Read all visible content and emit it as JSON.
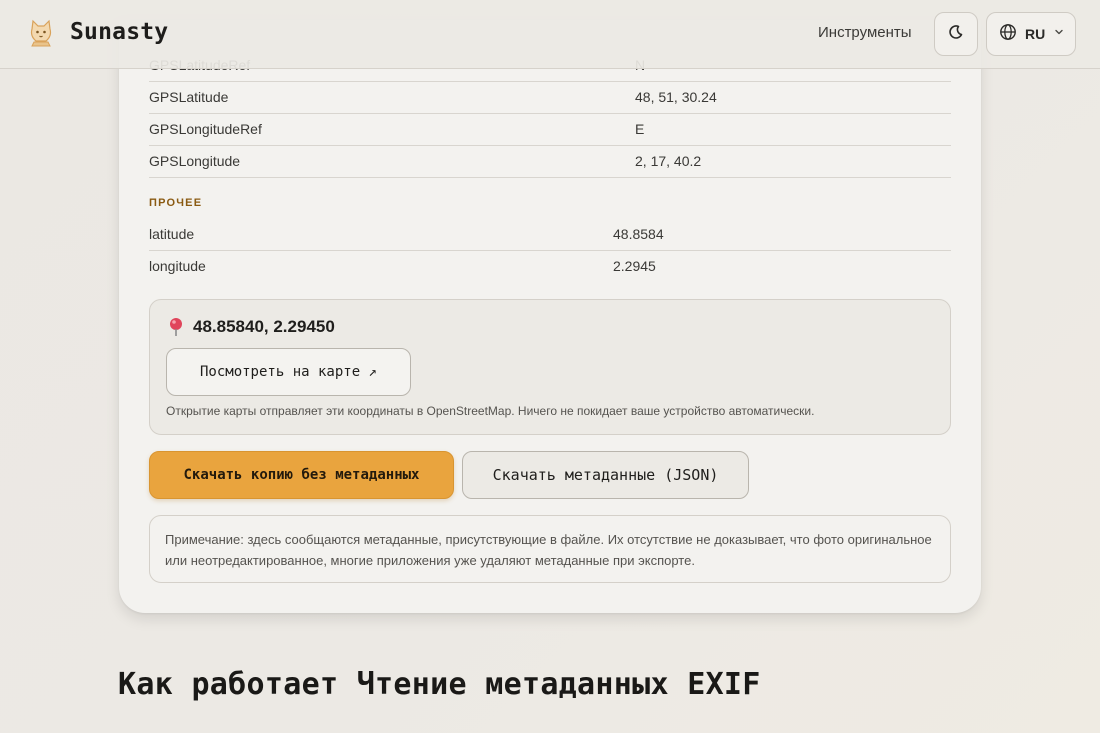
{
  "header": {
    "brand": "Sunasty",
    "nav_tools": "Инструменты",
    "theme_icon": "moon-icon",
    "language": "RU"
  },
  "metadata": {
    "gps_rows": [
      {
        "key": "GPSLatitudeRef",
        "value": "N"
      },
      {
        "key": "GPSLatitude",
        "value": "48, 51, 30.24"
      },
      {
        "key": "GPSLongitudeRef",
        "value": "E"
      },
      {
        "key": "GPSLongitude",
        "value": "2, 17, 40.2"
      }
    ],
    "other_title": "ПРОЧЕЕ",
    "other_rows": [
      {
        "key": "latitude",
        "value": "48.8584"
      },
      {
        "key": "longitude",
        "value": "2.2945"
      }
    ]
  },
  "geo": {
    "coords": "48.85840, 2.29450",
    "map_button": "Посмотреть на карте ↗",
    "note": "Открытие карты отправляет эти координаты в OpenStreetMap. Ничего не покидает ваше устройство автоматически."
  },
  "actions": {
    "download_clean": "Скачать копию без метаданных",
    "download_json": "Скачать метаданные (JSON)"
  },
  "disclaimer": "Примечание: здесь сообщаются метаданные, присутствующие в файле. Их отсутствие не доказывает, что фото оригинальное или неотредактированное, многие приложения уже удаляют метаданные при экспорте.",
  "section_heading": "Как работает Чтение метаданных EXIF",
  "colors": {
    "accent": "#e9a43e",
    "section_label": "#8a5a12",
    "background": "#ebe8e3"
  }
}
